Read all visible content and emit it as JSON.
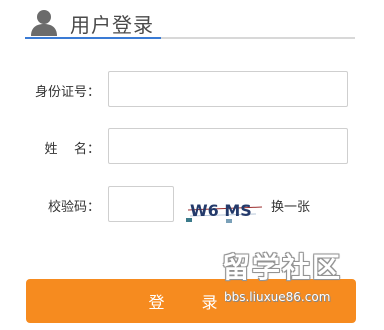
{
  "header": {
    "title": "用户登录"
  },
  "form": {
    "id_label": "身份证号：",
    "id_value": "",
    "name_label": "姓    名：",
    "name_value": "",
    "captcha_label": "校验码：",
    "captcha_value": "",
    "captcha_text": "W6 MS",
    "refresh_label": "换一张"
  },
  "login_button": {
    "label": "登 录"
  },
  "watermark": {
    "main": "留学社区",
    "url": "bbs.liuxue86.com"
  }
}
